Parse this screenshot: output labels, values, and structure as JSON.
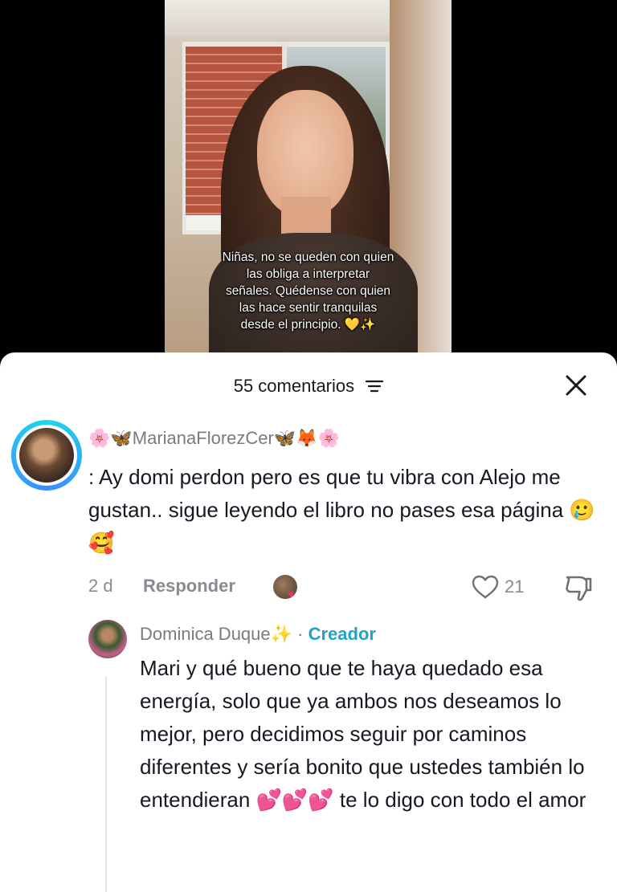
{
  "video": {
    "caption_lines": [
      "Niñas, no se queden con quien",
      "las obliga a interpretar",
      "señales. Quédense con quien",
      "las hace sentir tranquilas",
      "desde el principio. 💛✨"
    ]
  },
  "comments_panel": {
    "title": "55 comentarios",
    "filter_icon": "filter-lines-icon",
    "close_icon": "close-x-icon"
  },
  "comment": {
    "username": "🌸🦋MarianaFlorezCer🦋🦊🌸",
    "text": ": Ay domi perdon pero es que tu vibra con Alejo me gustan.. sigue leyendo el libro no pases esa página 🥲🥰",
    "age": "2 d",
    "reply_label": "Responder",
    "like_count": "21"
  },
  "reply": {
    "author": "Dominica Duque✨",
    "separator": " · ",
    "creator_badge": "Creador",
    "text": "Mari y qué bueno que te haya quedado esa energía, solo que ya ambos nos deseamos lo mejor, pero decidimos seguir por caminos diferentes y sería bonito que ustedes también lo entendieran 💕💕💕 te lo digo con todo el amor"
  },
  "colors": {
    "primary_text": "#161823",
    "secondary_text": "#8a8b91",
    "creator_accent": "#20a3c6",
    "avatar_ring": "#20d5ec"
  }
}
